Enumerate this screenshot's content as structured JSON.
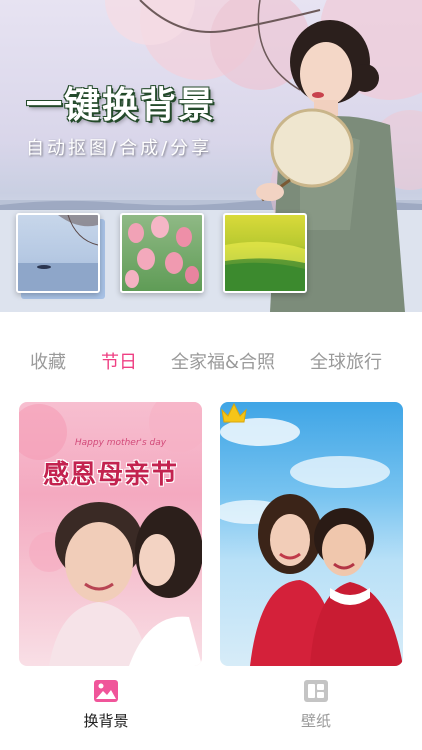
{
  "hero": {
    "title": "一键换背景",
    "subtitle": "自动抠图/合成/分享",
    "thumbnails": [
      {
        "name": "lake"
      },
      {
        "name": "tulips"
      },
      {
        "name": "rapeseed-field"
      }
    ]
  },
  "tabs": [
    {
      "label": "收藏",
      "active": false
    },
    {
      "label": "节日",
      "active": true
    },
    {
      "label": "全家福&合照",
      "active": false
    },
    {
      "label": "全球旅行",
      "active": false
    }
  ],
  "cards": [
    {
      "small_text": "Happy mother's day",
      "big_text": "感恩母亲节",
      "premium": false
    },
    {
      "premium": true,
      "badge_icon": "crown-icon"
    }
  ],
  "bottom_nav": [
    {
      "label": "换背景",
      "icon": "image-icon",
      "active": true
    },
    {
      "label": "壁纸",
      "icon": "wallpaper-icon",
      "active": false
    }
  ],
  "colors": {
    "accent": "#ef3f83",
    "tab_inactive": "#9a9a9a",
    "crown": "#f5c518"
  }
}
